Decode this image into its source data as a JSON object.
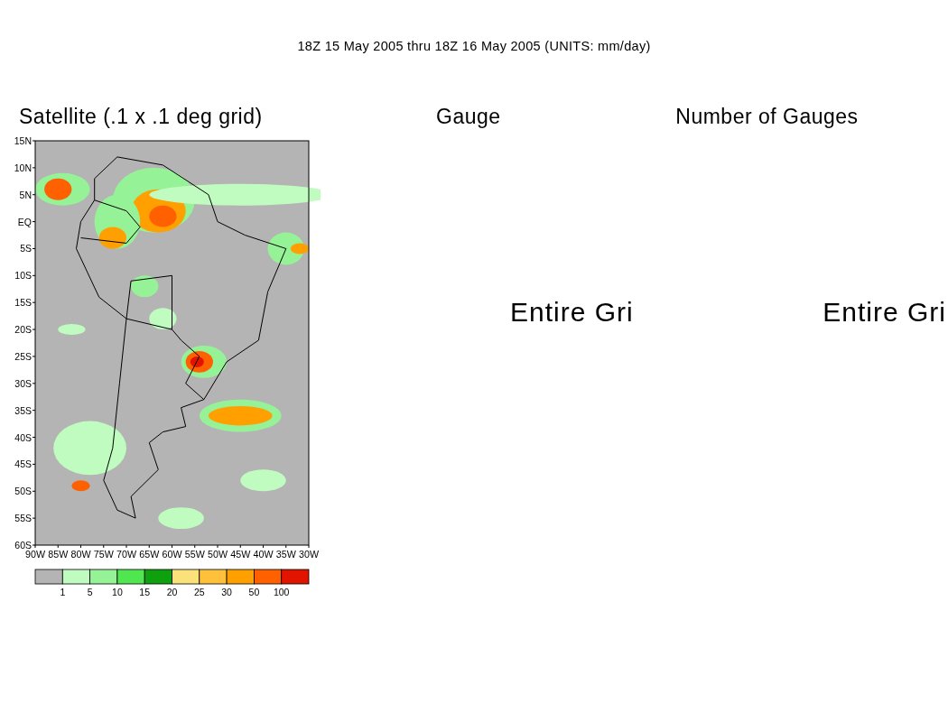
{
  "title": "18Z 15 May 2005 thru 18Z 16 May 2005 (UNITS: mm/day)",
  "panels": [
    {
      "kind": "map",
      "title": "Satellite (.1 x .1 deg grid)",
      "y_axis_labels": [
        "15N",
        "10N",
        "5N",
        "EQ",
        "5S",
        "10S",
        "15S",
        "20S",
        "25S",
        "30S",
        "35S",
        "40S",
        "45S",
        "50S",
        "55S",
        "60S"
      ],
      "x_axis_labels": [
        "90W",
        "85W",
        "80W",
        "75W",
        "70W",
        "65W",
        "60W",
        "55W",
        "50W",
        "45W",
        "40W",
        "35W",
        "30W"
      ],
      "colorbar": {
        "swatches": [
          {
            "color": "#b4b4b4"
          },
          {
            "color": "#c0fcc0"
          },
          {
            "color": "#96f296"
          },
          {
            "color": "#50e650"
          },
          {
            "color": "#0fa00f"
          },
          {
            "color": "#fae17a"
          },
          {
            "color": "#ffc03c"
          },
          {
            "color": "#ffa000"
          },
          {
            "color": "#ff6000"
          },
          {
            "color": "#e11400"
          }
        ],
        "labels": [
          "1",
          "5",
          "10",
          "15",
          "20",
          "25",
          "30",
          "50",
          "100"
        ]
      }
    },
    {
      "kind": "empty",
      "title": "Gauge",
      "message": "Entire Gri"
    },
    {
      "kind": "empty",
      "title": "Number of Gauges",
      "message": "Entire Gri"
    }
  ]
}
